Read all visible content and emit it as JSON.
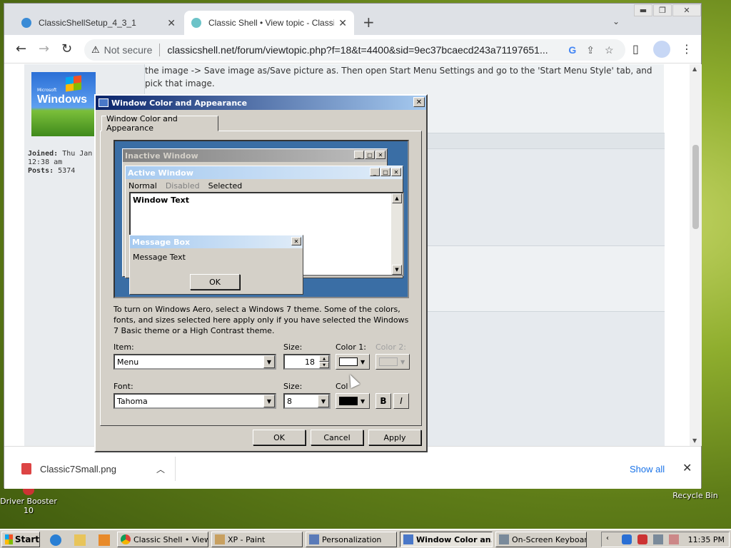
{
  "desktop": {
    "icons": [
      {
        "label": "Driver Booster 10"
      },
      {
        "label": "Recycle Bin"
      }
    ]
  },
  "browser": {
    "tabs": [
      {
        "title": "ClassicShellSetup_4_3_1",
        "active": false
      },
      {
        "title": "Classic Shell • View topic - Classic",
        "active": true
      }
    ],
    "omnibox": {
      "security": "Not secure",
      "url": "classicshell.net/forum/viewtopic.php?f=18&t=4400&sid=9ec37bcaecd243a71197651..."
    },
    "icons": {
      "back": "back-arrow-icon",
      "forward": "forward-arrow-icon",
      "reload": "reload-icon",
      "google": "google-icon",
      "share": "share-icon",
      "bookmark": "star-icon",
      "sidepanel": "side-panel-icon",
      "profile": "profile-icon",
      "menu": "kebab-menu-icon"
    }
  },
  "forum": {
    "post_text": "the image -> Save image as/Save picture as. Then open Start Menu Settings and go to the 'Start Menu Style' tab, and pick that image.",
    "avatar_text": {
      "brand": "Microsoft",
      "product": "Windows"
    },
    "user_meta": {
      "joined_label": "Joined:",
      "joined_value": "Thu Jan 0",
      "joined_time": "12:38 am",
      "posts_label": "Posts:",
      "posts_value": "5374"
    }
  },
  "downloads": {
    "file": "Classic7Small.png",
    "show_all": "Show all"
  },
  "dialog": {
    "title": "Window Color and Appearance",
    "tab": "Window Color and Appearance",
    "preview": {
      "inactive_title": "Inactive Window",
      "active_title": "Active Window",
      "menu_normal": "Normal",
      "menu_disabled": "Disabled",
      "menu_selected": "Selected",
      "window_text": "Window Text",
      "msgbox_title": "Message Box",
      "msgbox_text": "Message Text",
      "msgbox_ok": "OK"
    },
    "description": "To turn on Windows Aero, select a Windows 7 theme.  Some of the colors, fonts, and sizes selected here apply only if you have selected the Windows 7 Basic theme or a High Contrast theme.",
    "item_label": "Item:",
    "item_value": "Menu",
    "size_label": "Size:",
    "item_size_value": "18",
    "color1_label": "Color 1:",
    "color2_label": "Color 2:",
    "color1_value": "#ffffff",
    "font_label": "Font:",
    "font_value": "Tahoma",
    "font_size_label": "Size:",
    "font_size_value": "8",
    "font_color_label": "Col",
    "font_color_value": "#000000",
    "bold_label": "B",
    "italic_label": "I",
    "ok": "OK",
    "cancel": "Cancel",
    "apply": "Apply"
  },
  "taskbar": {
    "start": "Start",
    "tasks": [
      {
        "label": "Classic Shell • View...",
        "active": false
      },
      {
        "label": "XP - Paint",
        "active": false
      },
      {
        "label": "Personalization",
        "active": false
      },
      {
        "label": "Window Color an...",
        "active": true
      },
      {
        "label": "On-Screen Keyboard",
        "active": false
      }
    ],
    "clock": "11:35 PM"
  },
  "colors": {
    "active_title": "#0a246a",
    "inactive_title": "#808080",
    "desktop_preview": "#3a6ea5",
    "link": "#1a73e8"
  }
}
